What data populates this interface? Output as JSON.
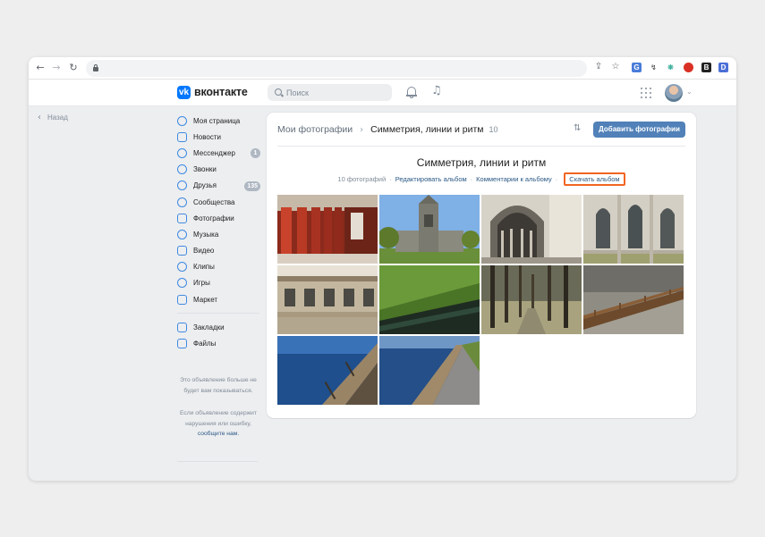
{
  "browser": {
    "ext_icons": [
      "translate-icon",
      "extension-icon",
      "extension-icon",
      "extension-icon",
      "extension-icon",
      "extension-icon"
    ]
  },
  "vk": {
    "wordmark": "вконтакте",
    "search_placeholder": "Поиск"
  },
  "back_label": "Назад",
  "menu": {
    "items": [
      {
        "label": "Моя страница",
        "icon": "user-icon"
      },
      {
        "label": "Новости",
        "icon": "news-icon"
      },
      {
        "label": "Мессенджер",
        "icon": "message-icon",
        "badge": "1"
      },
      {
        "label": "Звонки",
        "icon": "phone-icon"
      },
      {
        "label": "Друзья",
        "icon": "friends-icon",
        "badge": "135"
      },
      {
        "label": "Сообщества",
        "icon": "communities-icon"
      },
      {
        "label": "Фотографии",
        "icon": "photos-icon"
      },
      {
        "label": "Музыка",
        "icon": "music-icon"
      },
      {
        "label": "Видео",
        "icon": "video-icon"
      },
      {
        "label": "Клипы",
        "icon": "clips-icon"
      },
      {
        "label": "Игры",
        "icon": "games-icon"
      },
      {
        "label": "Маркет",
        "icon": "market-icon"
      }
    ],
    "secondary": [
      {
        "label": "Закладки",
        "icon": "bookmark-icon"
      },
      {
        "label": "Файлы",
        "icon": "file-icon"
      }
    ],
    "ad_notice": "Это объявление больше не будет вам показываться.",
    "ad_report_prefix": "Если объявление содержит нарушения или ошибку,",
    "ad_report_link": "сообщите нам."
  },
  "album": {
    "breadcrumb_root": "Мои фотографии",
    "breadcrumb_current": "Симметрия, линии и ритм",
    "count": "10",
    "add_button": "Добавить фотографии",
    "title": "Симметрия, линии и ритм",
    "meta_count": "10 фотографий",
    "edit_link": "Редактировать альбом",
    "comments_link": "Комментарии к альбому",
    "download_link": "Скачать альбом",
    "highlight_color": "#f16522",
    "photos": [
      {
        "name": "red-columns"
      },
      {
        "name": "gothic-tower"
      },
      {
        "name": "stone-arches"
      },
      {
        "name": "gothic-windows"
      },
      {
        "name": "ornate-facade"
      },
      {
        "name": "grass-embankment"
      },
      {
        "name": "tree-alley"
      },
      {
        "name": "park-railing"
      },
      {
        "name": "river-railing"
      },
      {
        "name": "embankment-walk"
      }
    ]
  },
  "colors": {
    "accent": "#0077ff",
    "button": "#5181b8",
    "link": "#2a5885"
  }
}
